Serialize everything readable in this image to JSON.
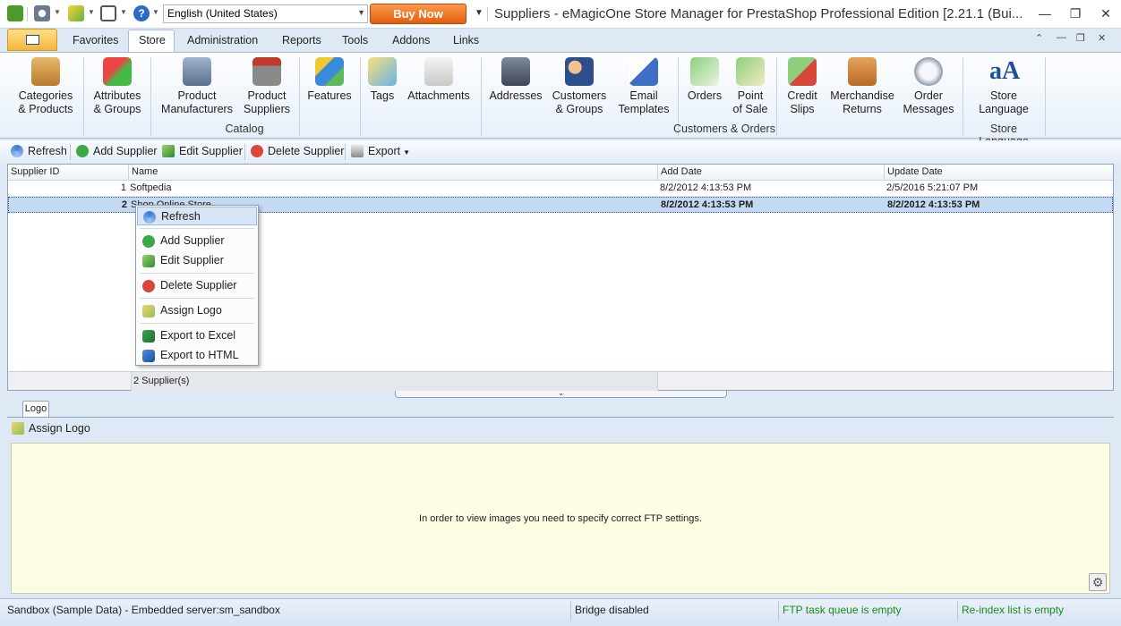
{
  "window": {
    "title": "Suppliers - eMagicOne Store Manager for PrestaShop Professional Edition [2.21.1 (Bui...",
    "language": "English (United States)",
    "buy_now": "Buy Now"
  },
  "menu": {
    "tabs": [
      "Favorites",
      "Store",
      "Administration",
      "Reports",
      "Tools",
      "Addons",
      "Links"
    ],
    "active_tab": "Store"
  },
  "ribbon": {
    "catalog": {
      "group": "Catalog",
      "buttons": [
        {
          "line1": "Categories",
          "line2": "& Products"
        },
        {
          "line1": "Attributes",
          "line2": "& Groups"
        },
        {
          "line1": "Product",
          "line2": "Manufacturers"
        },
        {
          "line1": "Product",
          "line2": "Suppliers"
        },
        {
          "line1": "Features",
          "line2": ""
        },
        {
          "line1": "Tags",
          "line2": ""
        },
        {
          "line1": "Attachments",
          "line2": ""
        }
      ]
    },
    "customers": {
      "group": "Customers & Orders",
      "buttons": [
        {
          "line1": "Addresses",
          "line2": ""
        },
        {
          "line1": "Customers",
          "line2": "& Groups"
        },
        {
          "line1": "Email",
          "line2": "Templates"
        },
        {
          "line1": "Orders",
          "line2": ""
        },
        {
          "line1": "Point",
          "line2": "of Sale"
        },
        {
          "line1": "Credit",
          "line2": "Slips"
        },
        {
          "line1": "Merchandise",
          "line2": "Returns"
        },
        {
          "line1": "Order",
          "line2": "Messages"
        }
      ]
    },
    "language": {
      "group": "Store Language",
      "buttons": [
        {
          "line1": "Store",
          "line2": "Language"
        }
      ]
    }
  },
  "toolbar": {
    "refresh": "Refresh",
    "add": "Add Supplier",
    "edit": "Edit Supplier",
    "delete": "Delete Supplier",
    "export": "Export"
  },
  "grid": {
    "columns": [
      "Supplier ID",
      "Name",
      "Add Date",
      "Update Date"
    ],
    "rows": [
      {
        "id": "1",
        "name": "Softpedia",
        "add_date": "8/2/2012 4:13:53 PM",
        "update_date": "2/5/2016 5:21:07 PM"
      },
      {
        "id": "2",
        "name": "Shop Online Store",
        "add_date": "8/2/2012 4:13:53 PM",
        "update_date": "8/2/2012 4:13:53 PM"
      }
    ],
    "footer_count": "2 Supplier(s)"
  },
  "context_menu": {
    "items": [
      "Refresh",
      "Add Supplier",
      "Edit Supplier",
      "Delete Supplier",
      "Assign Logo",
      "Export to Excel",
      "Export to HTML"
    ]
  },
  "logo_panel": {
    "tab": "Logo",
    "assign": "Assign Logo",
    "message": "In order to view images you need to specify correct FTP settings."
  },
  "status": {
    "connection": "Sandbox (Sample Data) - Embedded server:sm_sandbox",
    "bridge": "Bridge disabled",
    "ftp": "FTP task queue is empty",
    "reindex": "Re-index list is empty"
  },
  "colors": {
    "accent": "#2b579a",
    "buy_now": "#f07a21",
    "status_ok": "#1a8a1a",
    "selection": "#c5d9f1",
    "logo_bg": "#fdfde4"
  }
}
